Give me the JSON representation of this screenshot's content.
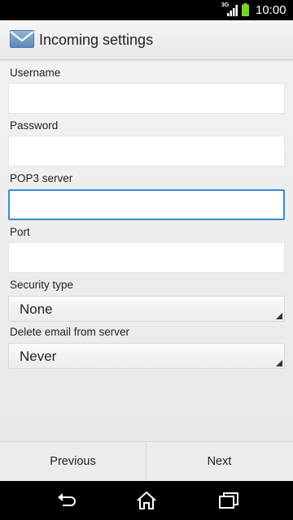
{
  "status_bar": {
    "network_type": "3G",
    "time": "10:00",
    "icons": [
      "signal-icon",
      "battery-icon"
    ]
  },
  "header": {
    "title": "Incoming settings",
    "icon": "email-icon"
  },
  "form": {
    "username": {
      "label": "Username",
      "value": "",
      "placeholder": ""
    },
    "password": {
      "label": "Password",
      "value": "",
      "placeholder": ""
    },
    "pop3_server": {
      "label": "POP3 server",
      "value": "",
      "placeholder": ""
    },
    "port": {
      "label": "Port",
      "value": "",
      "placeholder": ""
    },
    "security_type": {
      "label": "Security type",
      "selected": "None"
    },
    "delete_email": {
      "label": "Delete email from server",
      "selected": "Never"
    }
  },
  "buttons": {
    "previous": "Previous",
    "next": "Next"
  },
  "nav_bar": {
    "icons": [
      "back-icon",
      "home-icon",
      "recent-apps-icon"
    ]
  },
  "colors": {
    "focus_accent": "#2f8fd6",
    "status_bar_bg": "#000000",
    "battery": "#7ed321"
  }
}
